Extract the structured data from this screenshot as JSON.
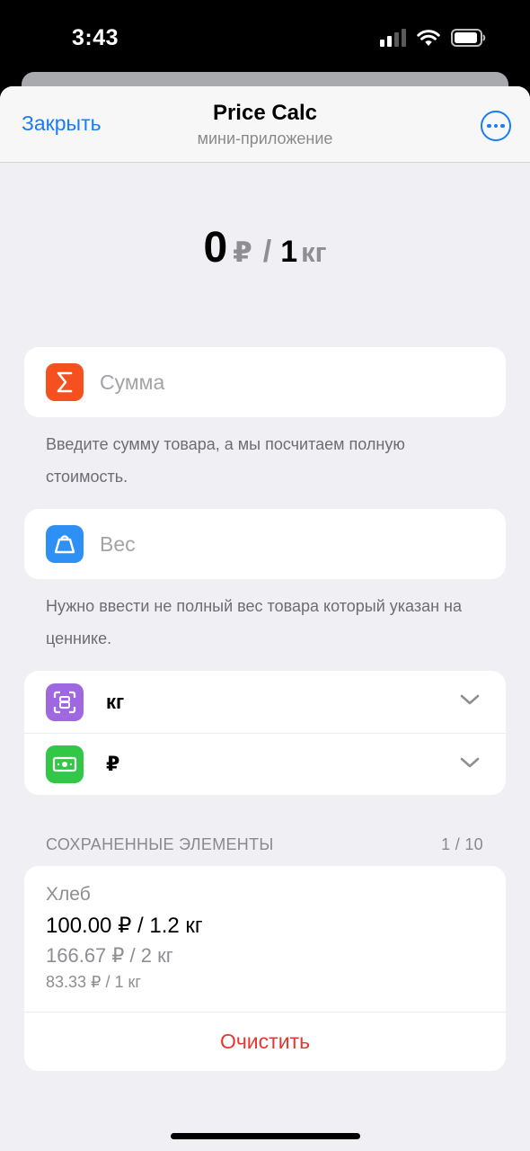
{
  "status_bar": {
    "time": "3:43",
    "icons": [
      "cellular-signal-icon",
      "wifi-icon",
      "battery-icon"
    ]
  },
  "navbar": {
    "close_label": "Закрыть",
    "title": "Price Calc",
    "subtitle": "мини-приложение",
    "more_icon": "ellipsis-circle-icon"
  },
  "result": {
    "price": "0",
    "currency": "₽",
    "separator": "/",
    "quantity": "1",
    "unit": "кг"
  },
  "sum_field": {
    "icon": "sigma-icon",
    "placeholder": "Сумма",
    "value": "",
    "hint": "Введите сумму товара, а мы посчитаем полную стоимость."
  },
  "weight_field": {
    "icon": "weight-icon",
    "placeholder": "Вес",
    "value": "",
    "hint": "Нужно ввести не полный вес товара который указан на ценнике."
  },
  "selectors": {
    "unit": {
      "icon": "scale-scan-icon",
      "value": "кг"
    },
    "currency": {
      "icon": "banknote-icon",
      "value": "₽"
    }
  },
  "saved": {
    "header": "СОХРАНЕННЫЕ ЭЛЕМЕНТЫ",
    "count": "1 / 10",
    "items": [
      {
        "name": "Хлеб",
        "main": "100.00 ₽ / 1.2 кг",
        "per_2kg": "166.67 ₽ / 2 кг",
        "per_1kg": "83.33 ₽ / 1 кг"
      }
    ],
    "clear_label": "Очистить"
  },
  "colors": {
    "accent": "#1a7cf0",
    "destructive": "#e5392f",
    "sum_icon_bg": "#f4511e",
    "weight_icon_bg": "#2e8ff5",
    "unit_icon_bg": "#a068e0",
    "currency_icon_bg": "#33c748",
    "background": "#efeff4"
  }
}
